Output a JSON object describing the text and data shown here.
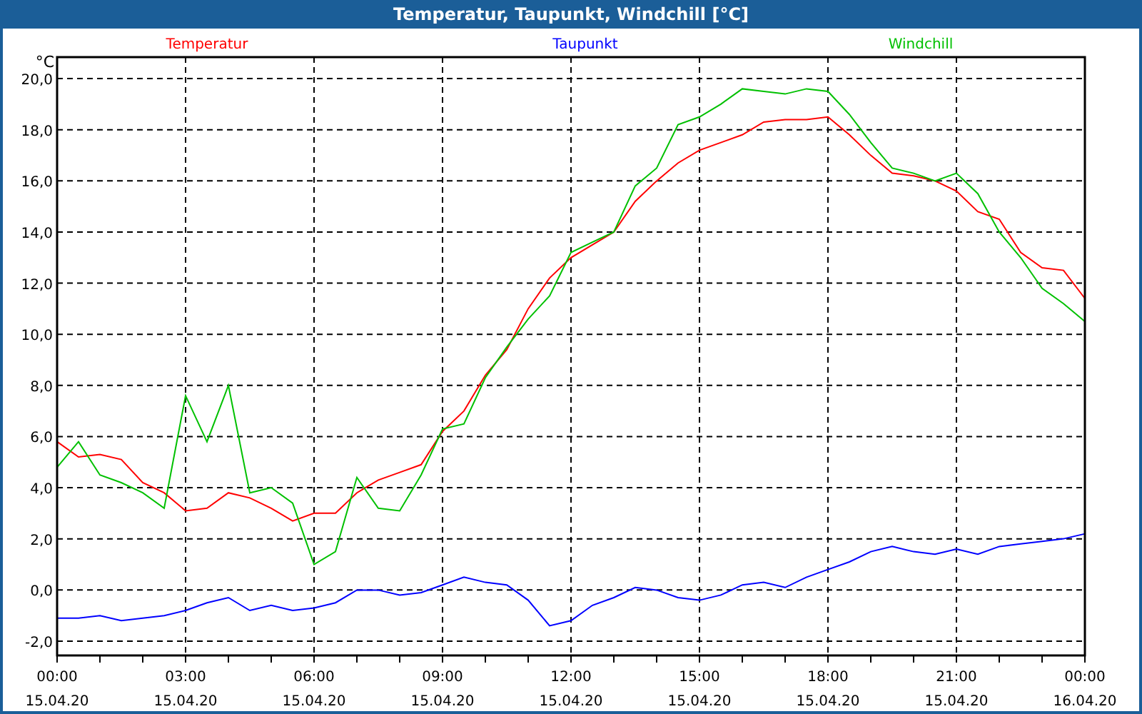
{
  "window": {
    "title": "Temperatur, Taupunkt, Windchill [°C]"
  },
  "chart": {
    "unit_label": "°C",
    "date_labels": [
      "15.04.20",
      "15.04.20",
      "15.04.20",
      "15.04.20",
      "15.04.20",
      "15.04.20",
      "15.04.20",
      "15.04.20",
      "16.04.20"
    ],
    "chart_data": {
      "type": "line",
      "grid": true,
      "x": [
        0,
        0.5,
        1,
        1.5,
        2,
        2.5,
        3,
        3.5,
        4,
        4.5,
        5,
        5.5,
        6,
        6.5,
        7,
        7.5,
        8,
        8.5,
        9,
        9.5,
        10,
        10.5,
        11,
        11.5,
        12,
        12.5,
        13,
        13.5,
        14,
        14.5,
        15,
        15.5,
        16,
        16.5,
        17,
        17.5,
        18,
        18.5,
        19,
        19.5,
        20,
        20.5,
        21,
        21.5,
        22,
        22.5,
        23,
        23.5,
        24
      ],
      "series": [
        {
          "name": "Temperatur",
          "color": "#ff0000",
          "values": [
            5.8,
            5.2,
            5.3,
            5.1,
            4.2,
            3.8,
            3.1,
            3.2,
            3.8,
            3.6,
            3.2,
            2.7,
            3.0,
            3.0,
            3.8,
            4.3,
            4.6,
            4.9,
            6.2,
            7.0,
            8.4,
            9.4,
            11.0,
            12.2,
            13.0,
            13.5,
            14.0,
            15.2,
            16.0,
            16.7,
            17.2,
            17.5,
            17.8,
            18.3,
            18.4,
            18.4,
            18.5,
            17.8,
            17.0,
            16.3,
            16.2,
            16.0,
            15.6,
            14.8,
            14.5,
            13.2,
            12.6,
            12.5,
            11.4
          ]
        },
        {
          "name": "Taupunkt",
          "color": "#0000ff",
          "values": [
            -1.1,
            -1.1,
            -1.0,
            -1.2,
            -1.1,
            -1.0,
            -0.8,
            -0.5,
            -0.3,
            -0.8,
            -0.6,
            -0.8,
            -0.7,
            -0.5,
            0.0,
            0.0,
            -0.2,
            -0.1,
            0.2,
            0.5,
            0.3,
            0.2,
            -0.4,
            -1.4,
            -1.2,
            -0.6,
            -0.3,
            0.1,
            0.0,
            -0.3,
            -0.4,
            -0.2,
            0.2,
            0.3,
            0.1,
            0.5,
            0.8,
            1.1,
            1.5,
            1.7,
            1.5,
            1.4,
            1.6,
            1.4,
            1.7,
            1.8,
            1.9,
            2.0,
            2.2
          ]
        },
        {
          "name": "Windchill",
          "color": "#00c000",
          "values": [
            4.8,
            5.8,
            4.5,
            4.2,
            3.8,
            3.2,
            7.6,
            5.8,
            8.0,
            3.8,
            4.0,
            3.4,
            1.0,
            1.5,
            4.4,
            3.2,
            3.1,
            4.5,
            6.3,
            6.5,
            8.3,
            9.5,
            10.6,
            11.5,
            13.2,
            13.6,
            14.0,
            15.8,
            16.5,
            18.2,
            18.5,
            19.0,
            19.6,
            19.5,
            19.4,
            19.6,
            19.5,
            18.6,
            17.5,
            16.5,
            16.3,
            16.0,
            16.3,
            15.5,
            14.0,
            13.0,
            11.8,
            11.2,
            10.5
          ]
        }
      ],
      "xlim": [
        0,
        24
      ],
      "ylim": [
        -2.56,
        20.84
      ],
      "xticks": [
        {
          "value": 0,
          "label": "00:00"
        },
        {
          "value": 3,
          "label": "03:00"
        },
        {
          "value": 6,
          "label": "06:00"
        },
        {
          "value": 9,
          "label": "09:00"
        },
        {
          "value": 12,
          "label": "12:00"
        },
        {
          "value": 15,
          "label": "15:00"
        },
        {
          "value": 18,
          "label": "18:00"
        },
        {
          "value": 21,
          "label": "21:00"
        },
        {
          "value": 24,
          "label": "00:00"
        }
      ],
      "yticks": [
        {
          "value": 20,
          "label": "20,0"
        },
        {
          "value": 18,
          "label": "18,0"
        },
        {
          "value": 16,
          "label": "16,0"
        },
        {
          "value": 14,
          "label": "14,0"
        },
        {
          "value": 12,
          "label": "12,0"
        },
        {
          "value": 10,
          "label": "10,0"
        },
        {
          "value": 8,
          "label": "8,0"
        },
        {
          "value": 6,
          "label": "6,0"
        },
        {
          "value": 4,
          "label": "4,0"
        },
        {
          "value": 2,
          "label": "2,0"
        },
        {
          "value": 0,
          "label": "0,0"
        },
        {
          "value": -2,
          "label": "-2,0"
        }
      ]
    }
  }
}
